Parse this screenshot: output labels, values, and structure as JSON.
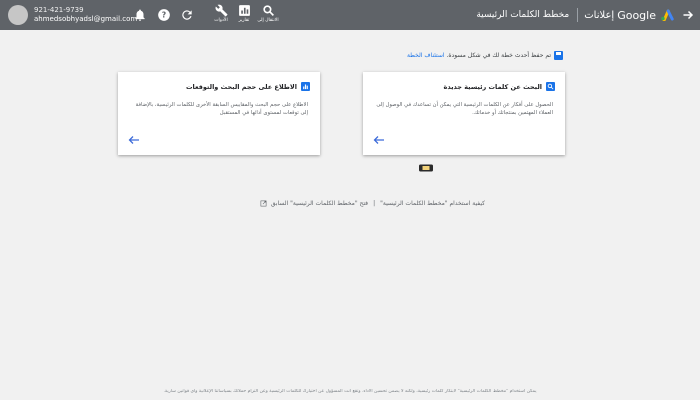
{
  "header": {
    "account_phone": "921-421-9739",
    "account_email": "ahmedsobhyadsl@gmail.com",
    "tools": [
      {
        "label": "الانتقال إلى"
      },
      {
        "label": "تقارير"
      },
      {
        "label": "الأدوات"
      }
    ],
    "brand_google": "Google",
    "brand_ads": "إعلانات",
    "page_title": "مخطط الكلمات الرئيسية"
  },
  "save_note": {
    "text": "تم حفظ أحدث خطة لك في شكل مسودة.",
    "link": "استئناف الخطة"
  },
  "cards": {
    "discover": {
      "title": "البحث عن كلمات رئيسية جديدة",
      "description": "الحصول على أفكار عن الكلمات الرئيسية التي يمكن أن تساعدك في الوصول إلى العملاء المهتمين بمنتجاتك أو خدماتك."
    },
    "forecast": {
      "title": "الاطلاع على حجم البحث والتوقعات",
      "description": "الاطلاع على حجم البحث والمقاييس السابقة الأخرى للكلمات الرئيسية، بالإضافة إلى توقعات لمستوى أدائها في المستقبل"
    }
  },
  "links": {
    "how_to": "كيفية استخدام \"مخطط الكلمات الرئيسية\"",
    "separator": "|",
    "open_previous": "فتح \"مخطط الكلمات الرئيسية\" السابق"
  },
  "footer": "يمكن استخدام \"مخطط الكلمات الرئيسية\" لابتكار كلمات رئيسية، ولكنه لا يضمن تحسين الأداء. وتقع أنت المسؤول عن اختيارك للكلمات الرئيسية وعن التزام حملاتك بسياساتنا الإعلانية وأي قوانين سارية."
}
